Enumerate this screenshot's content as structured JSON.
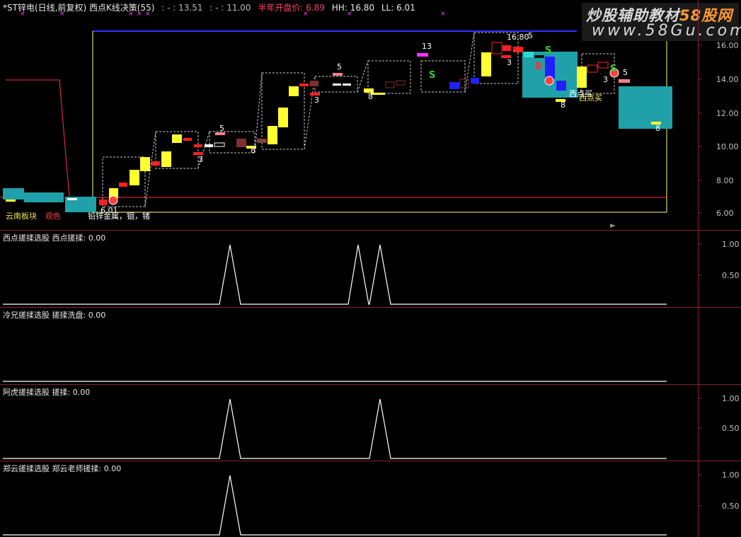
{
  "header": {
    "title": "*ST锌电(日线,前复权) 西点K线决策(55)",
    "dash1": ": - : 13.51",
    "dash2": ": - : 11.00",
    "half_year_label": "半年开盘价: 6.89",
    "hh": "HH: 16.80",
    "ll": "LL: 6.01"
  },
  "watermark": {
    "line1": "炒股辅助教材",
    "brand": "58股网",
    "line2": "www.58Gu.com"
  },
  "main_chart": {
    "y_ticks": [
      "16.00",
      "14.00",
      "12.00",
      "10.00",
      "8.00",
      "6.00"
    ],
    "labels": {
      "low": "6.01",
      "high": "16.80",
      "sector": "云南板块",
      "sector_tag": "观色",
      "industry": "铅锌金属，铟，锗",
      "buy1": "西点买",
      "buy2": "西点买",
      "n13": "13",
      "n5a": "5",
      "n5b": "5",
      "n5c": "5",
      "n5d": "5",
      "n3a": "3",
      "n3b": "3",
      "n3c": "3",
      "n3d": "3",
      "n8a": "8",
      "n8b": "8",
      "n8c": "8",
      "n8d": "8",
      "s1": "S",
      "s2": "S",
      "s3": "S",
      "b1": "B"
    }
  },
  "pane1": {
    "label": "西点搓揉选股 西点搓揉: 0.00",
    "ticks": [
      "1.00",
      "0.50"
    ]
  },
  "pane2": {
    "label": "冷兄搓揉选股 搓揉洗盘: 0.00"
  },
  "pane3": {
    "label": "阿虎搓揉选股 搓揉: 0.00",
    "ticks": [
      "1.00",
      "0.50"
    ]
  },
  "pane4": {
    "label": "郑云搓揉选股 郑云老师搓揉: 0.00",
    "ticks": [
      "1.00",
      "0.50"
    ]
  },
  "colors": {
    "up": "#ffff30",
    "down": "#ff2020",
    "teal": "#20a0a8",
    "grid": "#8a2030",
    "blue": "#2020ff"
  }
}
